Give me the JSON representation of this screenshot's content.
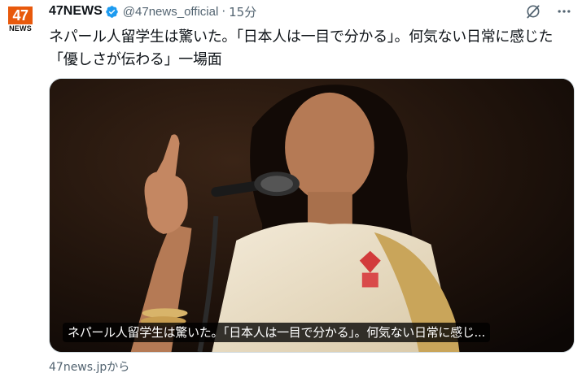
{
  "account": {
    "avatar_top": "47",
    "avatar_bottom": "NEWS",
    "display_name": "47NEWS",
    "handle": "@47news_official",
    "separator": "·",
    "time": "15分",
    "verified_color": "#1d9bf0",
    "brand_color": "#e8590c"
  },
  "header_icons": [
    "grok-icon",
    "more-icon"
  ],
  "tweet": {
    "text": "ネパール人留学生は驚いた。「日本人は一目で分かる」。何気ない日常に感じた「優しさが伝わる」一場面"
  },
  "card": {
    "caption": "ネパール人留学生は驚いた。「日本人は一目で分かる」。何気ない日常に感じ...",
    "source": "47news.jpから"
  }
}
